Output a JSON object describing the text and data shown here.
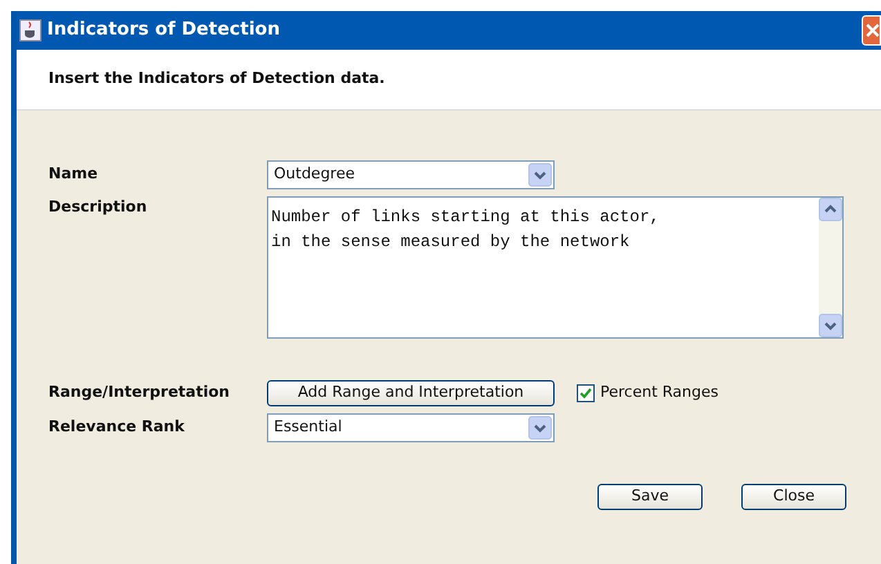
{
  "window": {
    "title": "Indicators of Detection"
  },
  "header": {
    "text": "Insert the Indicators of Detection data."
  },
  "form": {
    "name": {
      "label": "Name",
      "value": "Outdegree"
    },
    "description": {
      "label": "Description",
      "lines": [
        "Number of links starting at this actor,",
        "in the sense measured by the network"
      ]
    },
    "range": {
      "label": "Range/Interpretation",
      "button": "Add Range and Interpretation",
      "checkbox": {
        "label": "Percent Ranges",
        "checked": true
      }
    },
    "relevance": {
      "label": "Relevance Rank",
      "value": "Essential"
    }
  },
  "buttons": [
    "Save",
    "Close"
  ]
}
